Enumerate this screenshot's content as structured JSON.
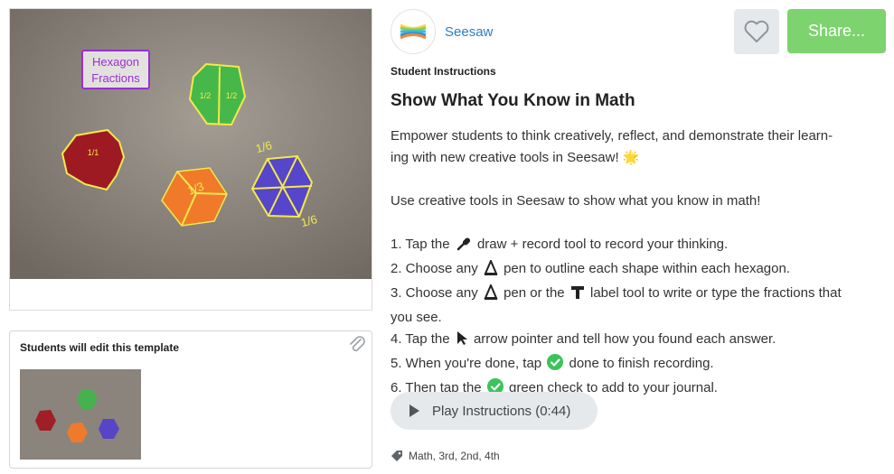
{
  "hero": {
    "label": "Hexagon Fractions",
    "fraction_labels": [
      "1/1",
      "1/2",
      "1/2",
      "1/3",
      "1/6",
      "1/6"
    ]
  },
  "template": {
    "title": "Students will edit this template"
  },
  "brand": {
    "name": "Seesaw"
  },
  "actions": {
    "share_label": "Share..."
  },
  "content": {
    "section_label": "Student Instructions",
    "title": "Show What You Know in Math",
    "intro_line": "Empower students to think creatively, reflect, and demonstrate their learn-ing with new creative tools in Seesaw! 🌟",
    "intro_line1": "Empower students to think creatively, reflect, and demonstrate their learn-",
    "intro_line2": "ing with new creative tools in Seesaw!",
    "intro_emoji": "🌟",
    "goal": "Use creative tools in Seesaw to show what you know in math!",
    "steps": [
      {
        "pre": "1. Tap the",
        "post": "draw + record tool to record your thinking.",
        "icon": "microphone-icon"
      },
      {
        "pre": "2. Choose any",
        "post": "pen to outline each shape within each hexagon.",
        "icon": "pen-icon"
      },
      {
        "pre": "3. Choose any",
        "mid": "pen or the",
        "post": "label tool to write or type the fractions that",
        "post2": "you see.",
        "icon": "pen-icon",
        "icon2": "label-tool-icon"
      },
      {
        "pre": "4. Tap the",
        "post": "arrow pointer and tell how you found each answer.",
        "icon": "arrow-pointer-icon"
      },
      {
        "pre": "5. When you're done, tap",
        "post": "done to finish recording.",
        "icon": "green-check-icon"
      },
      {
        "pre": "6. Then tap the",
        "post": "green check to add to your journal.",
        "icon": "green-check-icon"
      }
    ]
  },
  "audio": {
    "label": "Play Instructions (0:44)"
  },
  "tags": {
    "text": "Math, 3rd, 2nd, 4th"
  },
  "colors": {
    "share": "#7dd36e",
    "brand_link": "#2a7dc4",
    "button_gray": "#e6e9ec",
    "check_green": "#3cc35a"
  }
}
